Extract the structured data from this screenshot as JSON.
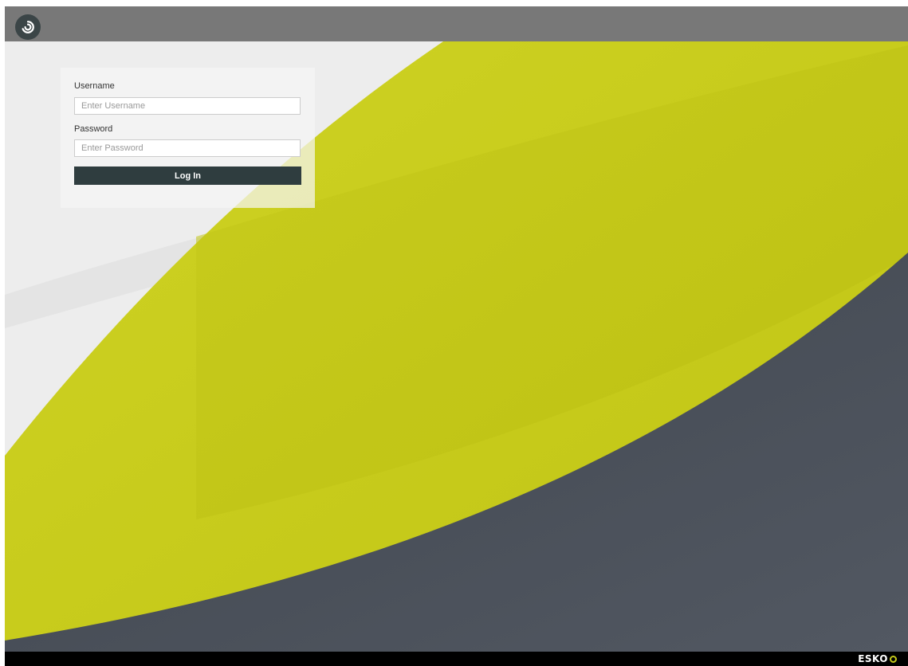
{
  "app": {
    "logo_icon": "swirl-icon",
    "brand_name": "ESKO",
    "brand_icon": "esko-flower-icon"
  },
  "login": {
    "username_label": "Username",
    "username_placeholder": "Enter Username",
    "username_value": "",
    "password_label": "Password",
    "password_placeholder": "Enter Password",
    "password_value": "",
    "submit_label": "Log In"
  },
  "colors": {
    "topbar": "#787878",
    "accent_yellow": "#c3c716",
    "dark_slate": "#474d57",
    "button": "#2f3d3f",
    "footer": "#000000"
  }
}
